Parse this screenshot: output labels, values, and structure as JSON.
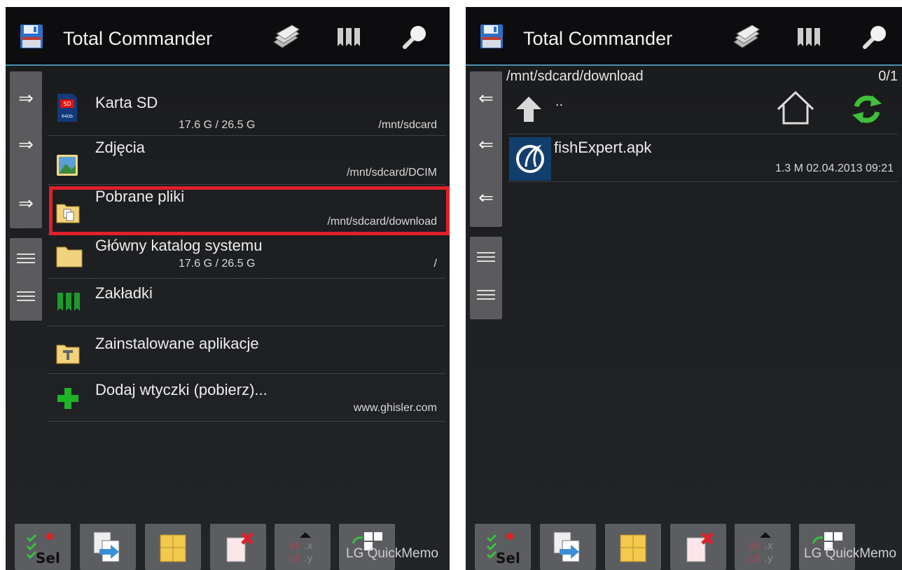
{
  "left_panel": {
    "app_title": "Total Commander",
    "items": [
      {
        "name": "Karta SD",
        "size": "17.6 G / 26.5 G",
        "path": "/mnt/sdcard",
        "icon": "sd-card-icon"
      },
      {
        "name": "Zdjęcia",
        "size": "",
        "path": "/mnt/sdcard/DCIM",
        "icon": "photo-folder-icon"
      },
      {
        "name": "Pobrane pliki",
        "size": "",
        "path": "/mnt/sdcard/download",
        "icon": "download-folder-icon"
      },
      {
        "name": "Główny katalog systemu",
        "size": "17.6 G / 26.5 G",
        "path": "/",
        "icon": "folder-icon"
      },
      {
        "name": "Zakładki",
        "size": "",
        "path": "",
        "icon": "bookmarks-icon"
      },
      {
        "name": "Zainstalowane aplikacje",
        "size": "",
        "path": "",
        "icon": "apps-folder-icon"
      },
      {
        "name": "Dodaj wtyczki (pobierz)...",
        "size": "",
        "path": "www.ghisler.com",
        "icon": "plus-icon"
      }
    ],
    "watermark": "LG QuickMemo"
  },
  "right_panel": {
    "app_title": "Total Commander",
    "current_path": "/mnt/sdcard/download",
    "selection_count": "0/1",
    "up_label": "..",
    "files": [
      {
        "name": "fishExpert.apk",
        "size": "1.3 M",
        "date": "02.04.2013",
        "time": "09:21"
      }
    ],
    "watermark": "LG QuickMemo"
  },
  "colors": {
    "background": "#1c1d1f",
    "titlebar": "#0d0d0f",
    "accent_line": "#4a8fb0",
    "highlight": "#e0202a",
    "button": "#5c5d60"
  },
  "bottom_buttons": [
    "Sel",
    "copy",
    "pack",
    "delete",
    "rename",
    "multi-window"
  ]
}
